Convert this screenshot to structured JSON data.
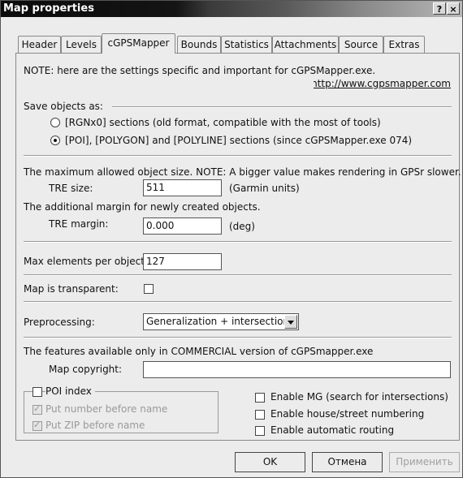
{
  "window": {
    "title": "Map properties",
    "help_glyph": "?",
    "close_glyph": "×"
  },
  "tabs": [
    "Header",
    "Levels",
    "cGPSMapper",
    "Bounds",
    "Statistics",
    "Attachments",
    "Source",
    "Extras"
  ],
  "active_tab": "cGPSMapper",
  "note": {
    "text": "NOTE: here are the settings specific and important for cGPSMapper.exe.",
    "link": "http://www.cgpsmapper.com"
  },
  "save_objects": {
    "label": "Save objects as:",
    "options": [
      {
        "label": "[RGNx0] sections (old format, compatible with the most of tools)",
        "selected": false
      },
      {
        "label": "[POI], [POLYGON] and [POLYLINE] sections (since cGPSMapper.exe 074)",
        "selected": true
      }
    ]
  },
  "tre": {
    "note": "The maximum allowed object size. NOTE: A bigger value makes rendering in GPSr slower.",
    "size_label": "TRE size:",
    "size_value": "511",
    "size_unit": "(Garmin units)",
    "margin_note": "The additional margin for newly created objects.",
    "margin_label": "TRE margin:",
    "margin_value": "0.000",
    "margin_unit": "(deg)"
  },
  "max_elements": {
    "label": "Max elements per object:",
    "value": "127"
  },
  "transparent": {
    "label": "Map is transparent:",
    "checked": false
  },
  "preprocessing": {
    "label": "Preprocessing:",
    "value": "Generalization + intersection"
  },
  "commercial": {
    "note": "The features available only in COMMERCIAL version of cGPSmapper.exe",
    "copyright_label": "Map copyright:",
    "copyright_value": "",
    "poi_index": "POI index",
    "put_number": "Put number before name",
    "put_zip": "Put ZIP before name",
    "enable_mg": "Enable MG (search for intersections)",
    "enable_house": "Enable house/street numbering",
    "enable_routing": "Enable automatic routing"
  },
  "buttons": {
    "ok": "OK",
    "cancel": "Отмена",
    "apply": "Применить"
  }
}
